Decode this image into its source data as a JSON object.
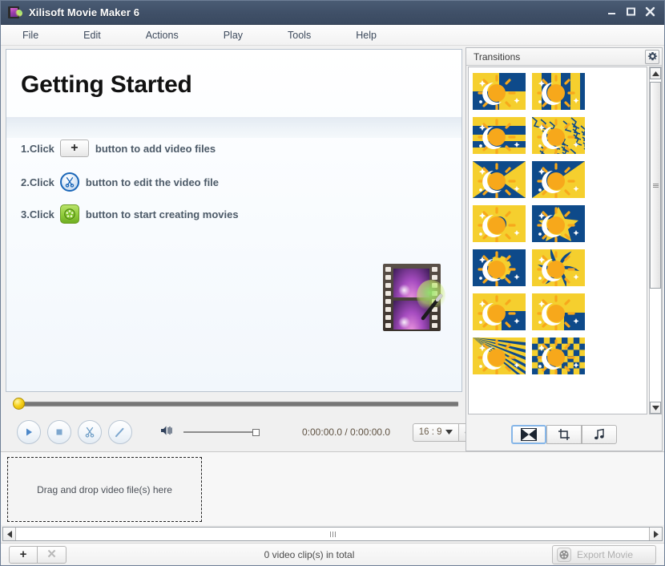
{
  "window": {
    "title": "Xilisoft Movie Maker 6",
    "icon": "film-wand-icon",
    "controls": [
      {
        "name": "minimize-button",
        "glyph": "minimize-icon"
      },
      {
        "name": "maximize-button",
        "glyph": "maximize-icon"
      },
      {
        "name": "close-button",
        "glyph": "close-icon"
      }
    ]
  },
  "menubar": {
    "items": [
      {
        "label": "File"
      },
      {
        "label": "Edit"
      },
      {
        "label": "Actions"
      },
      {
        "label": "Play"
      },
      {
        "label": "Tools"
      },
      {
        "label": "Help"
      }
    ]
  },
  "preview": {
    "heading": "Getting Started",
    "steps": [
      {
        "prefix": "1.Click",
        "icon": "plus-icon",
        "suffix": "button to add video files"
      },
      {
        "prefix": "2.Click",
        "icon": "scissors-icon",
        "suffix": "button to edit the video file"
      },
      {
        "prefix": "3.Click",
        "icon": "film-reel-icon",
        "suffix": "button to start creating movies"
      }
    ],
    "logo_icon": "film-strip-magic-wand-icon"
  },
  "transport": {
    "seek_position_percent": 0,
    "buttons": [
      {
        "name": "play-button",
        "icon": "play-icon"
      },
      {
        "name": "stop-button",
        "icon": "stop-icon"
      },
      {
        "name": "cut-button",
        "icon": "scissors-icon"
      },
      {
        "name": "edit-button",
        "icon": "pencil-icon"
      }
    ],
    "volume_icon": "speaker-icon",
    "volume_percent": 100,
    "time": "0:00:00.0 / 0:00:00.0",
    "aspect_ratio": "16 : 9",
    "aspect_dropdown_icon": "chevron-down-icon",
    "fit_button_icon": "fit-to-screen-icon"
  },
  "transitions": {
    "title": "Transitions",
    "settings_icon": "gear-icon",
    "scrollbar": {
      "up_icon": "scroll-up-icon",
      "down_icon": "scroll-down-icon",
      "thumb_position_percent": 4
    },
    "items": [
      {
        "name": "checkerboard-quads",
        "style": "quads"
      },
      {
        "name": "vertical-bars",
        "style": "vbars"
      },
      {
        "name": "horizontal-bands",
        "style": "hbands"
      },
      {
        "name": "crackle",
        "style": "crackle"
      },
      {
        "name": "diagonal-cross",
        "style": "xcross"
      },
      {
        "name": "diagonal-wipe",
        "style": "diag"
      },
      {
        "name": "circle-reveal",
        "style": "circle"
      },
      {
        "name": "star-reveal",
        "style": "star"
      },
      {
        "name": "radial-dots",
        "style": "dots"
      },
      {
        "name": "pinwheel-spiral",
        "style": "spiral"
      },
      {
        "name": "corner-wipe",
        "style": "corner"
      },
      {
        "name": "split-wipe",
        "style": "split"
      },
      {
        "name": "ray-burst",
        "style": "rays"
      },
      {
        "name": "checkerboard",
        "style": "checker"
      }
    ],
    "tabs": [
      {
        "name": "tab-transitions",
        "icon": "transition-bowtie-icon",
        "selected": true
      },
      {
        "name": "tab-crop",
        "icon": "crop-icon",
        "selected": false
      },
      {
        "name": "tab-music",
        "icon": "music-note-icon",
        "selected": false
      }
    ]
  },
  "storyboard": {
    "drop_hint": "Drag and drop video file(s) here",
    "hscroll": {
      "left_icon": "scroll-left-icon",
      "right_icon": "scroll-right-icon"
    }
  },
  "statusbar": {
    "add_label": "+",
    "delete_label": "✕",
    "clip_count": "0 video clip(s) in total",
    "export_label": "Export Movie",
    "export_icon": "film-reel-icon"
  },
  "colors": {
    "titlebar": "#405068",
    "accent_blue": "#1a66b8",
    "transition_blue": "#0e4a8a",
    "transition_yellow": "#f5cf2e",
    "transition_orange": "#f7a81b"
  }
}
